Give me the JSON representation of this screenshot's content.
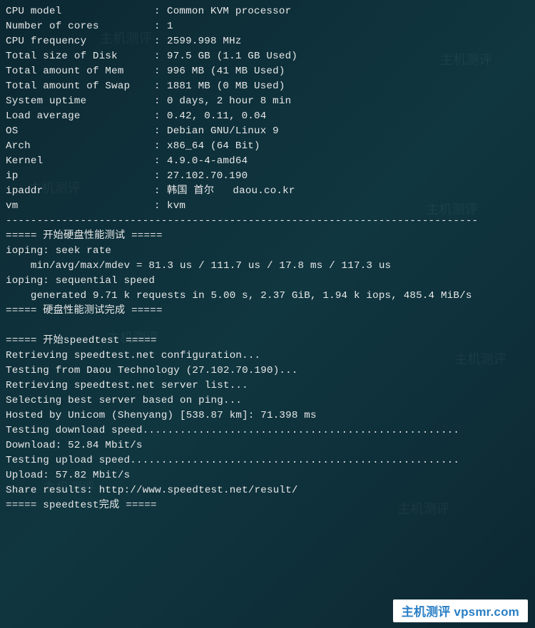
{
  "sysinfo": [
    {
      "label": "CPU model",
      "value": "Common KVM processor"
    },
    {
      "label": "Number of cores",
      "value": "1"
    },
    {
      "label": "CPU frequency",
      "value": "2599.998 MHz"
    },
    {
      "label": "Total size of Disk",
      "value": "97.5 GB (1.1 GB Used)"
    },
    {
      "label": "Total amount of Mem",
      "value": "996 MB (41 MB Used)"
    },
    {
      "label": "Total amount of Swap",
      "value": "1881 MB (0 MB Used)"
    },
    {
      "label": "System uptime",
      "value": "0 days, 2 hour 8 min"
    },
    {
      "label": "Load average",
      "value": "0.42, 0.11, 0.04"
    },
    {
      "label": "OS",
      "value": "Debian GNU/Linux 9"
    },
    {
      "label": "Arch",
      "value": "x86_64 (64 Bit)"
    },
    {
      "label": "Kernel",
      "value": "4.9.0-4-amd64"
    },
    {
      "label": "ip",
      "value": "27.102.70.190"
    },
    {
      "label": "ipaddr",
      "value": "韩国 首尔   daou.co.kr"
    },
    {
      "label": "vm",
      "value": "kvm"
    }
  ],
  "separator": "----------------------------------------------------------------------------",
  "disk": {
    "header_start": "===== 开始硬盘性能测试 =====",
    "line1": "ioping: seek rate",
    "line2": "    min/avg/max/mdev = 81.3 us / 111.7 us / 17.8 ms / 117.3 us",
    "line3": "ioping: sequential speed",
    "line4": "    generated 9.71 k requests in 5.00 s, 2.37 GiB, 1.94 k iops, 485.4 MiB/s",
    "header_end": "===== 硬盘性能测试完成 ====="
  },
  "speed": {
    "header_start": "===== 开始speedtest =====",
    "l1": "Retrieving speedtest.net configuration...",
    "l2": "Testing from Daou Technology (27.102.70.190)...",
    "l3": "Retrieving speedtest.net server list...",
    "l4": "Selecting best server based on ping...",
    "l5": "Hosted by Unicom (Shenyang) [538.87 km]: 71.398 ms",
    "l6": "Testing download speed...................................................",
    "l7": "Download: 52.84 Mbit/s",
    "l8": "Testing upload speed.....................................................",
    "l9": "Upload: 57.82 Mbit/s",
    "l10": "Share results: http://www.speedtest.net/result/",
    "header_end": "===== speedtest完成 ====="
  },
  "watermark": "主机测评 vpsmr.com",
  "faint_watermark": "主机测评"
}
